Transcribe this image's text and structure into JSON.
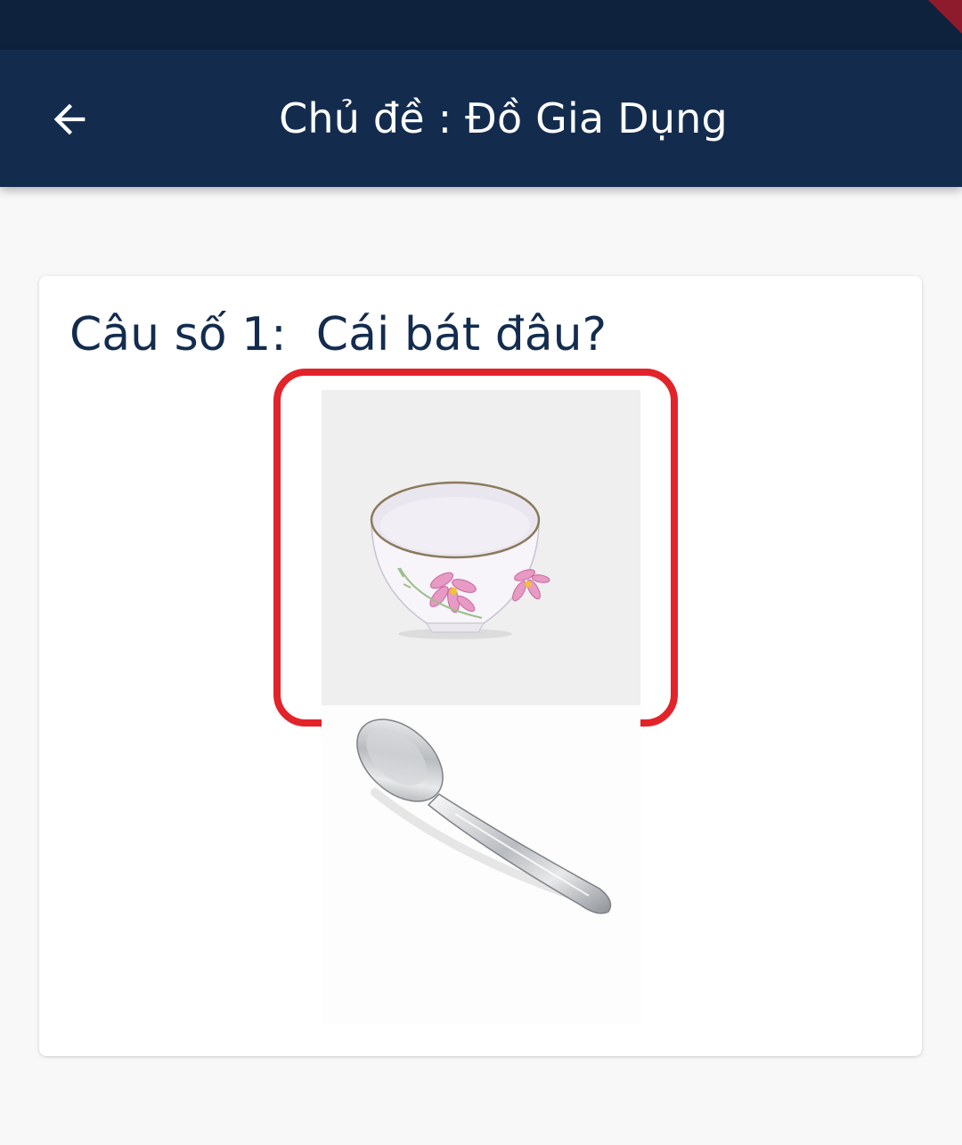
{
  "header": {
    "title": "Chủ đề : Đồ Gia Dụng",
    "back_icon": "arrow-left-icon"
  },
  "colors": {
    "status_bar": "#0e213d",
    "app_bar": "#132c4e",
    "question_text": "#132c4e",
    "selected_outline": "#e2232a",
    "background": "#f8f8f8"
  },
  "quiz": {
    "question_label": "Câu số 1:  Cái bát đâu?",
    "options": [
      {
        "item": "bowl-image",
        "selected": true
      },
      {
        "item": "spoon-image",
        "selected": false
      }
    ]
  }
}
